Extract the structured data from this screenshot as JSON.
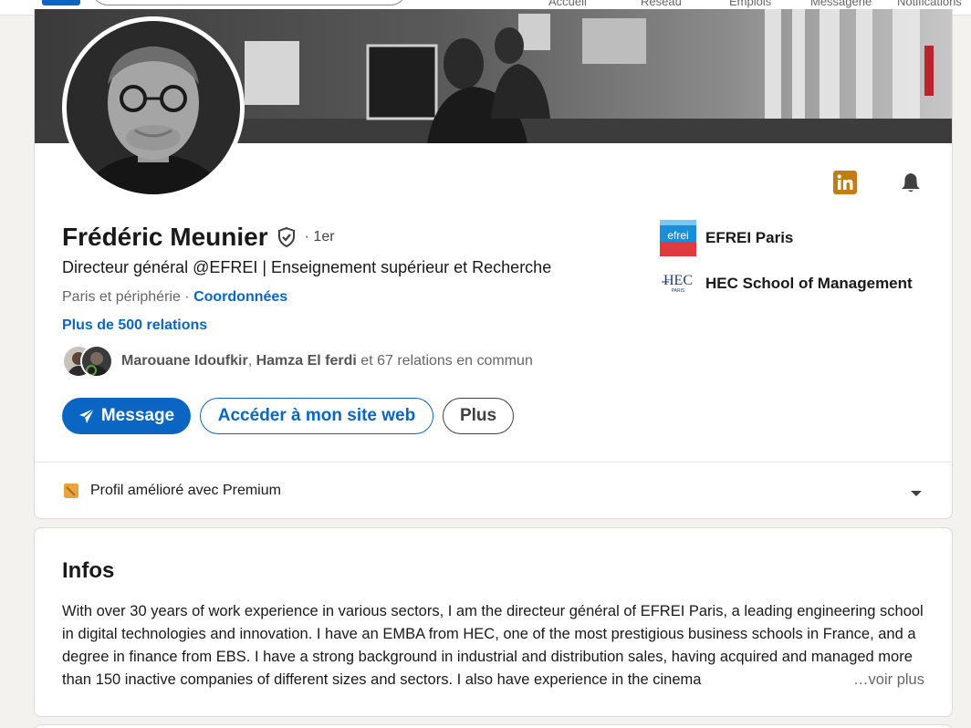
{
  "nav": {
    "items": [
      "Accueil",
      "Réseau",
      "Emplois",
      "Messagerie",
      "Notifications"
    ]
  },
  "profile": {
    "name": "Frédéric Meunier",
    "degree": "· 1er",
    "headline": "Directeur général @EFREI | Enseignement supérieur et Recherche",
    "location": "Paris et périphérie",
    "location_sep": " · ",
    "contact_link": "Coordonnées",
    "connections": "Plus de 500 relations",
    "mutual": {
      "name1": "Marouane Idoufkir",
      "sep": ", ",
      "name2": "Hamza El ferdi",
      "rest": " et 67 relations en commun"
    },
    "actions": {
      "message": "Message",
      "website": "Accéder à mon site web",
      "more": "Plus"
    },
    "organizations": [
      {
        "name": "EFREI Paris",
        "logo_text": "efrei"
      },
      {
        "name": "HEC School of Management",
        "logo_text": "HEC",
        "logo_sub": "PARIS"
      }
    ],
    "premium": "Profil amélioré avec Premium"
  },
  "infos": {
    "title": "Infos",
    "text": "With over 30 years of work experience in various sectors, I am the directeur général of EFREI Paris, a leading engineering school in digital technologies and innovation. I have an EMBA from HEC, one of the most prestigious business schools in France, and a degree in finance from EBS. I have a strong background in industrial and distribution sales, having acquired and managed more than 150 inactive companies of different sizes and sectors. I also have experience in the cinema",
    "see_more": "…voir plus"
  },
  "colors": {
    "brand": "#0a66c2",
    "premium": "#c37d16",
    "linkedin_badge": "#c37d16"
  },
  "icons": {
    "verified": "shield-check-icon",
    "send": "paper-plane-icon",
    "bell": "bell-icon",
    "linkedin": "linkedin-icon",
    "chevron": "chevron-down-icon"
  }
}
